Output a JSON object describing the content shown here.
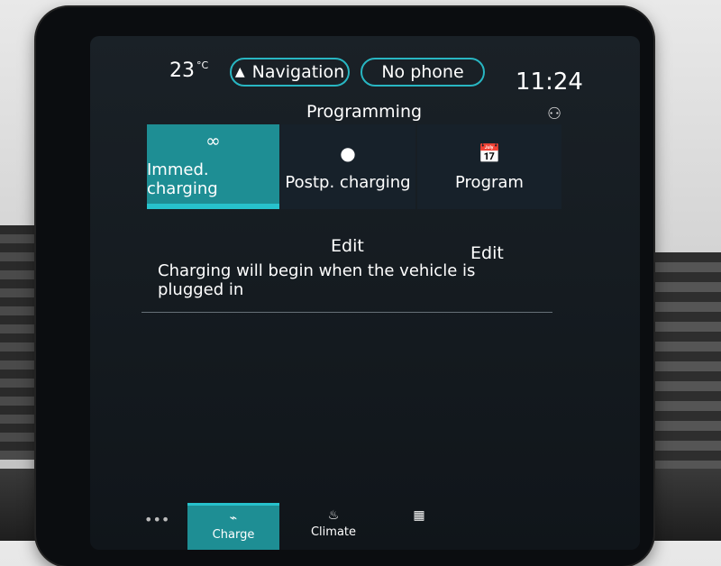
{
  "status": {
    "temperature": "23",
    "temperature_unit": "°C",
    "time": "11:24"
  },
  "header": {
    "navigation_label": "Navigation",
    "phone_label": "No phone"
  },
  "section": {
    "title": "Programming"
  },
  "tabs": [
    {
      "label": "Immed. charging",
      "icon": "infinity-icon",
      "glyph": "∞",
      "selected": true
    },
    {
      "label": "Postp. charging",
      "icon": "clock-icon",
      "glyph": "●",
      "selected": false
    },
    {
      "label": "Program",
      "icon": "calendar-check-icon",
      "glyph": "📅",
      "selected": false
    }
  ],
  "edits": [
    {
      "label": "Edit"
    },
    {
      "label": "Edit"
    }
  ],
  "message": "Charging will begin when the vehicle is plugged in",
  "bottom_nav": [
    {
      "label": "Charge",
      "icon": "charge-icon",
      "glyph": "⌁",
      "selected": true
    },
    {
      "label": "Climate",
      "icon": "climate-icon",
      "glyph": "♨",
      "selected": false
    },
    {
      "label": "",
      "icon": "calendar-icon",
      "glyph": "▦",
      "selected": false
    }
  ],
  "colors": {
    "accent": "#27c2cc",
    "selected_fill": "#1e8e94",
    "screen_bg": "#141a1f"
  }
}
